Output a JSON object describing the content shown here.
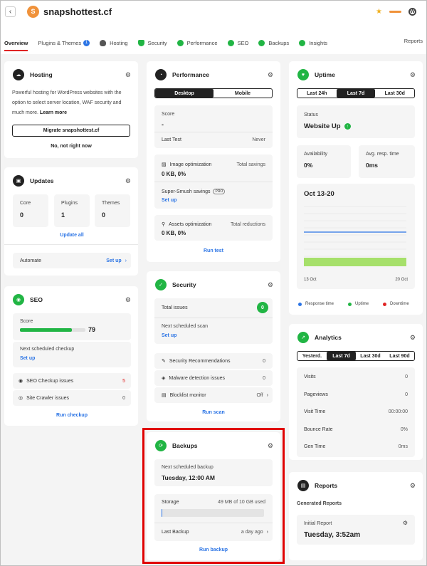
{
  "topbar": {
    "site_initial": "S",
    "site_name": "snapshottest.cf"
  },
  "nav": {
    "tabs": [
      {
        "label": "Overview"
      },
      {
        "label": "Plugins & Themes",
        "badge": "1"
      },
      {
        "label": "Hosting"
      },
      {
        "label": "Security"
      },
      {
        "label": "Performance"
      },
      {
        "label": "SEO"
      },
      {
        "label": "Backups"
      },
      {
        "label": "Insights"
      }
    ],
    "reports": "Reports"
  },
  "hosting": {
    "title": "Hosting",
    "desc": "Powerful hosting for WordPress websites with the option to select server location, WAF security and much more.",
    "learn": "Learn more",
    "migrate": "Migrate snapshottest.cf",
    "decline": "No, not right now"
  },
  "updates": {
    "title": "Updates",
    "core_label": "Core",
    "core_val": "0",
    "plugins_label": "Plugins",
    "plugins_val": "1",
    "themes_label": "Themes",
    "themes_val": "0",
    "update_all": "Update all",
    "automate": "Automate",
    "setup": "Set up"
  },
  "seo": {
    "title": "SEO",
    "score_label": "Score",
    "score_val": "79",
    "score": 0.79,
    "next_label": "Next scheduled checkup",
    "setup": "Set up",
    "issues_label": "SEO Checkup issues",
    "issues_val": "5",
    "crawler_label": "Site Crawler issues",
    "crawler_val": "0",
    "run": "Run checkup"
  },
  "performance": {
    "title": "Performance",
    "tab_desktop": "Desktop",
    "tab_mobile": "Mobile",
    "score_label": "Score",
    "score_val": "-",
    "last_test_label": "Last Test",
    "last_test_val": "Never",
    "img_label": "Image optimization",
    "img_savings": "Total savings",
    "img_val": "0 KB, 0%",
    "smush_label": "Super-Smush savings",
    "smush_badge": "PRO",
    "setup": "Set up",
    "assets_label": "Assets optimization",
    "assets_red": "Total reductions",
    "assets_val": "0 KB, 0%",
    "run": "Run test"
  },
  "security": {
    "title": "Security",
    "total_label": "Total issues",
    "total_val": "0",
    "next_label": "Next scheduled scan",
    "setup": "Set up",
    "rec_label": "Security Recommendations",
    "rec_val": "0",
    "malware_label": "Malware detection issues",
    "malware_val": "0",
    "blocklist_label": "Blocklist monitor",
    "blocklist_val": "Off",
    "run": "Run scan"
  },
  "backups": {
    "title": "Backups",
    "next_label": "Next scheduled backup",
    "next_val": "Tuesday, 12:00 AM",
    "storage_label": "Storage",
    "storage_val": "49 MB of 10 GB used",
    "storage_fill": 0.005,
    "last_label": "Last Backup",
    "last_val": "a day ago",
    "run": "Run backup"
  },
  "uptime": {
    "title": "Uptime",
    "tab_24h": "Last 24h",
    "tab_7d": "Last 7d",
    "tab_30d": "Last 30d",
    "status_label": "Status",
    "status_val": "Website Up",
    "avail_label": "Availability",
    "avail_val": "0%",
    "resp_label": "Avg. resp. time",
    "resp_val": "0ms",
    "range": "Oct 13-20",
    "x_start": "13 Oct",
    "x_end": "20 Oct",
    "legend_resp": "Response time",
    "legend_up": "Uptime",
    "legend_down": "Downtime"
  },
  "analytics": {
    "title": "Analytics",
    "tab_y": "Yesterd.",
    "tab_7d": "Last 7d",
    "tab_30d": "Last 30d",
    "tab_90d": "Last 90d",
    "visits_label": "Visits",
    "visits_val": "0",
    "pv_label": "Pageviews",
    "pv_val": "0",
    "vt_label": "Visit Time",
    "vt_val": "00:00:00",
    "br_label": "Bounce Rate",
    "br_val": "0%",
    "gt_label": "Gen Time",
    "gt_val": "0ms"
  },
  "reports": {
    "title": "Reports",
    "generated": "Generated Reports",
    "initial_label": "Initial Report",
    "initial_val": "Tuesday, 3:52am"
  },
  "colors": {
    "accent": "#2b74e5",
    "active_tab": "#e02424",
    "success": "#21b544",
    "brand": "#f0923a",
    "highlight": "#e00000"
  }
}
